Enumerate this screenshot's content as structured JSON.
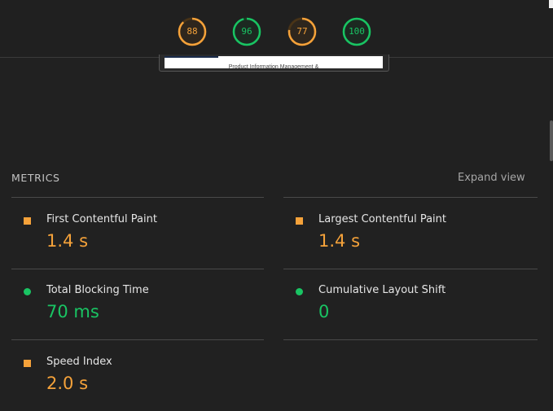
{
  "scores": [
    {
      "value": "88",
      "fraction": 0.88,
      "color": "#f5a23a",
      "track": "#4a3417"
    },
    {
      "value": "96",
      "fraction": 0.96,
      "color": "#19c463",
      "track": "#163c25"
    },
    {
      "value": "77",
      "fraction": 0.77,
      "color": "#f5a23a",
      "track": "#4a3417"
    },
    {
      "value": "100",
      "fraction": 1.0,
      "color": "#19c463",
      "track": "#163c25"
    }
  ],
  "thumbnail": {
    "text": "Product Information Management &"
  },
  "metrics_section": {
    "title": "METRICS",
    "expand_label": "Expand view"
  },
  "metrics": [
    {
      "label": "First Contentful Paint",
      "value": "1.4 s",
      "status": "average"
    },
    {
      "label": "Largest Contentful Paint",
      "value": "1.4 s",
      "status": "average"
    },
    {
      "label": "Total Blocking Time",
      "value": "70 ms",
      "status": "pass"
    },
    {
      "label": "Cumulative Layout Shift",
      "value": "0",
      "status": "pass"
    },
    {
      "label": "Speed Index",
      "value": "2.0 s",
      "status": "average"
    }
  ],
  "colors": {
    "average": "#f5a23a",
    "pass": "#19c463",
    "background": "#212121"
  }
}
